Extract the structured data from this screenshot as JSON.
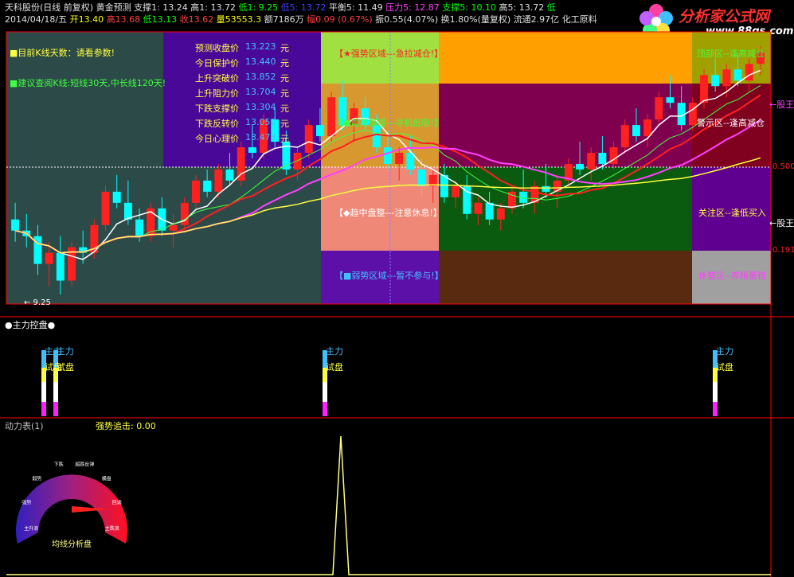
{
  "header": {
    "line1": [
      {
        "t": "天科股份(日线 前复权)",
        "c": "#e0e0e0"
      },
      {
        "t": "黄金预测",
        "c": "#e0e0e0"
      },
      {
        "t": "支撑1: 13.24",
        "c": "#e0e0e0"
      },
      {
        "t": "高1: 13.72",
        "c": "#e0e0e0"
      },
      {
        "t": "低1: 9.25",
        "c": "#00ff00"
      },
      {
        "t": "低5: 13.72",
        "c": "#4040ff"
      },
      {
        "t": "平衡5: 11.49",
        "c": "#e0e0e0"
      },
      {
        "t": "压力5: 12.87",
        "c": "#ff40ff"
      },
      {
        "t": "支撑5: 10.10",
        "c": "#00ff00"
      },
      {
        "t": "高5: 13.72",
        "c": "#e0e0e0"
      },
      {
        "t": "低",
        "c": "#00ff00"
      }
    ],
    "line2": [
      {
        "t": "2014/04/18/五",
        "c": "#e0e0e0"
      },
      {
        "t": "开13.40",
        "c": "#ffff00"
      },
      {
        "t": "高13.68",
        "c": "#ff4040"
      },
      {
        "t": "低13.13",
        "c": "#00ff00"
      },
      {
        "t": "收13.62",
        "c": "#ff4040"
      },
      {
        "t": "量53553.3",
        "c": "#ffff00"
      },
      {
        "t": "额7186万",
        "c": "#e0e0e0"
      },
      {
        "t": "幅0.09",
        "c": "#ff4040"
      },
      {
        "t": "(0.67%)",
        "c": "#ff4040"
      },
      {
        "t": "振0.55(4.07%)",
        "c": "#e0e0e0"
      },
      {
        "t": "换1.80%(量复权)",
        "c": "#e0e0e0"
      },
      {
        "t": "流通2.97亿",
        "c": "#e0e0e0"
      },
      {
        "t": "化工原料",
        "c": "#e0e0e0"
      }
    ]
  },
  "logo": {
    "title": "分析家公式网",
    "url": "www.88gs.com"
  },
  "info_panel": {
    "days_label": "■目前K线天数：请看参数!",
    "advice_label": "■建议查阅K线:短线30天,中长线120天!",
    "rows": [
      {
        "name": "预测收盘价",
        "value": "13.223",
        "unit": "元"
      },
      {
        "name": "今日保护价",
        "value": "13.440",
        "unit": "元"
      },
      {
        "name": "上升突破价",
        "value": "13.852",
        "unit": "元"
      },
      {
        "name": "上升阻力价",
        "value": "13.704",
        "unit": "元"
      },
      {
        "name": "下跌支撑价",
        "value": "13.304",
        "unit": "元"
      },
      {
        "name": "下跌反转价",
        "value": "13.052",
        "unit": "元"
      },
      {
        "name": "今日心理价",
        "value": "13.473",
        "unit": "元"
      }
    ]
  },
  "zones": {
    "strong": "【★强势区域---急拉减仓!】",
    "swing": "【●震荡整理---寻机低吸!】",
    "mid": "【◆趋中盘整---注意休息!】",
    "weak": "【■弱势区域---暂不参与!】",
    "alert": "警示区--逢高减仓",
    "focus": "关注区--逢低买入",
    "rest": "休整区--养精蓄锐",
    "top_right": "顶部区--逢高减仓"
  },
  "right_axis": {
    "v1": "0.500",
    "v2": "0.191",
    "arrow1": "←股王",
    "arrow2": "←股王"
  },
  "main_chart_min_label": "← 9.25",
  "panel2": {
    "title": "●主力控盘●",
    "label_a": "主力",
    "label_b": "试盘"
  },
  "panel3": {
    "title": "动力表(1)",
    "strong_chase": "强势追击: 0.00",
    "gauge_caption": "均线分析盘",
    "gauge_markers": [
      "主升浪",
      "强势",
      "弱势",
      "下跌",
      "超跌反弹",
      "横盘",
      "回调",
      "主跌浪"
    ]
  },
  "colors": {
    "up": "#ff2020",
    "down": "#00ffff",
    "ma_red": "#ff2020",
    "ma_white": "#ffffff",
    "ma_green": "#40ff40",
    "ma_magenta": "#ff40ff",
    "ma_yellow": "#ffff40",
    "bg": "#000000",
    "frame": "#ff0000"
  },
  "chart_data": {
    "type": "candlestick",
    "note": "values estimated from pixels; approx price scale 9.25 to 13.72",
    "ohlc_count": 156,
    "min_price": 9.25,
    "max_price": 13.72,
    "candles": [
      [
        10.6,
        10.9,
        10.2,
        10.4
      ],
      [
        10.4,
        10.7,
        10.1,
        10.3
      ],
      [
        10.3,
        10.5,
        9.6,
        9.8
      ],
      [
        9.8,
        10.2,
        9.4,
        10.0
      ],
      [
        10.0,
        10.3,
        9.25,
        9.5
      ],
      [
        9.5,
        10.2,
        9.4,
        10.1
      ],
      [
        10.1,
        10.4,
        9.8,
        10.0
      ],
      [
        10.0,
        10.6,
        9.9,
        10.5
      ],
      [
        10.5,
        11.2,
        10.4,
        11.1
      ],
      [
        11.1,
        11.4,
        10.8,
        10.9
      ],
      [
        10.9,
        11.3,
        10.5,
        10.6
      ],
      [
        10.6,
        10.8,
        10.2,
        10.3
      ],
      [
        10.3,
        10.9,
        10.2,
        10.8
      ],
      [
        10.8,
        11.0,
        10.3,
        10.4
      ],
      [
        10.4,
        10.7,
        10.1,
        10.5
      ],
      [
        10.5,
        11.0,
        10.4,
        10.9
      ],
      [
        10.9,
        11.4,
        10.8,
        11.3
      ],
      [
        11.3,
        11.5,
        11.0,
        11.1
      ],
      [
        11.1,
        11.6,
        11.0,
        11.5
      ],
      [
        11.5,
        11.8,
        11.2,
        11.3
      ],
      [
        11.3,
        12.0,
        11.2,
        11.9
      ],
      [
        11.9,
        12.3,
        11.7,
        11.8
      ],
      [
        11.8,
        12.5,
        11.7,
        12.4
      ],
      [
        12.4,
        12.6,
        11.9,
        12.0
      ],
      [
        12.0,
        12.2,
        11.4,
        11.5
      ],
      [
        11.5,
        11.9,
        11.3,
        11.8
      ],
      [
        11.8,
        12.4,
        11.7,
        12.3
      ],
      [
        12.3,
        12.6,
        12.0,
        12.1
      ],
      [
        12.1,
        12.9,
        12.0,
        12.8
      ],
      [
        12.8,
        13.1,
        12.2,
        12.3
      ],
      [
        12.3,
        12.7,
        12.0,
        12.6
      ],
      [
        12.6,
        12.8,
        12.2,
        12.3
      ],
      [
        12.3,
        12.5,
        11.8,
        11.9
      ],
      [
        11.9,
        12.2,
        11.5,
        11.6
      ],
      [
        11.6,
        11.9,
        11.3,
        11.8
      ],
      [
        11.8,
        12.1,
        11.4,
        11.5
      ],
      [
        11.5,
        11.7,
        11.0,
        11.2
      ],
      [
        11.2,
        11.5,
        10.9,
        11.4
      ],
      [
        11.4,
        11.6,
        10.9,
        11.0
      ],
      [
        11.0,
        11.3,
        10.8,
        11.2
      ],
      [
        11.2,
        11.4,
        10.6,
        10.7
      ],
      [
        10.7,
        11.0,
        10.5,
        10.9
      ],
      [
        10.9,
        11.1,
        10.5,
        10.6
      ],
      [
        10.6,
        10.9,
        10.4,
        10.8
      ],
      [
        10.8,
        11.2,
        10.7,
        11.1
      ],
      [
        11.1,
        11.5,
        10.8,
        10.9
      ],
      [
        10.9,
        11.3,
        10.7,
        11.2
      ],
      [
        11.2,
        11.6,
        11.0,
        11.1
      ],
      [
        11.1,
        11.4,
        10.8,
        11.3
      ],
      [
        11.3,
        11.7,
        11.2,
        11.6
      ],
      [
        11.6,
        12.0,
        11.4,
        11.5
      ],
      [
        11.5,
        11.9,
        11.3,
        11.8
      ],
      [
        11.8,
        12.1,
        11.5,
        11.6
      ],
      [
        11.6,
        12.0,
        11.5,
        11.9
      ],
      [
        11.9,
        12.4,
        11.8,
        12.3
      ],
      [
        12.3,
        12.6,
        12.0,
        12.1
      ],
      [
        12.1,
        12.5,
        11.9,
        12.4
      ],
      [
        12.4,
        12.9,
        12.3,
        12.8
      ],
      [
        12.8,
        13.2,
        12.6,
        12.7
      ],
      [
        12.7,
        13.0,
        12.2,
        12.3
      ],
      [
        12.3,
        12.8,
        12.2,
        12.7
      ],
      [
        12.7,
        13.3,
        12.6,
        13.2
      ],
      [
        13.2,
        13.5,
        12.9,
        13.0
      ],
      [
        13.0,
        13.4,
        12.8,
        13.3
      ],
      [
        13.3,
        13.6,
        13.0,
        13.1
      ],
      [
        13.1,
        13.5,
        12.9,
        13.4
      ],
      [
        13.4,
        13.72,
        13.2,
        13.62
      ]
    ]
  }
}
